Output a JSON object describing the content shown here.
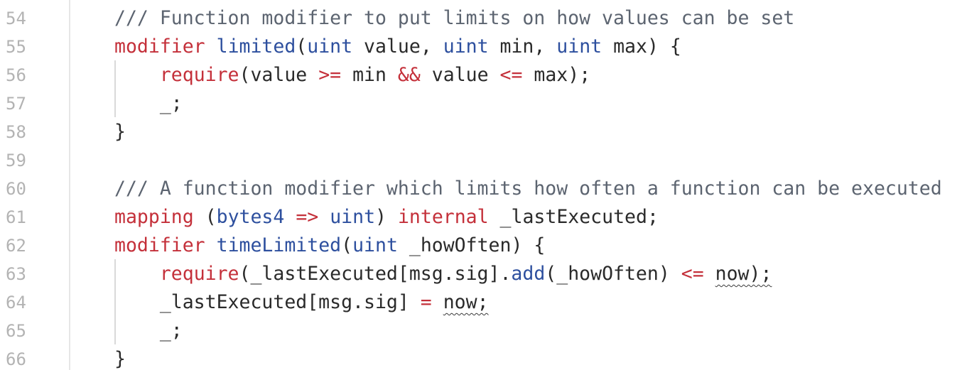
{
  "editor": {
    "lines": [
      {
        "num": "54",
        "tokens": [
          {
            "t": "/// Function modifier to put limits on how values can be set",
            "k": "cm"
          }
        ]
      },
      {
        "num": "55",
        "tokens": [
          {
            "t": "modifier",
            "k": "kw"
          },
          {
            "t": " ",
            "k": "plain"
          },
          {
            "t": "limited",
            "k": "fn"
          },
          {
            "t": "(",
            "k": "plain"
          },
          {
            "t": "uint",
            "k": "type"
          },
          {
            "t": " value, ",
            "k": "plain"
          },
          {
            "t": "uint",
            "k": "type"
          },
          {
            "t": " min, ",
            "k": "plain"
          },
          {
            "t": "uint",
            "k": "type"
          },
          {
            "t": " max) {",
            "k": "plain"
          }
        ]
      },
      {
        "num": "56",
        "tokens": [
          {
            "t": "    ",
            "k": "plain"
          },
          {
            "t": "require",
            "k": "kw"
          },
          {
            "t": "(value ",
            "k": "plain"
          },
          {
            "t": ">=",
            "k": "op"
          },
          {
            "t": " min ",
            "k": "plain"
          },
          {
            "t": "&&",
            "k": "op"
          },
          {
            "t": " value ",
            "k": "plain"
          },
          {
            "t": "<=",
            "k": "op"
          },
          {
            "t": " max);",
            "k": "plain"
          }
        ]
      },
      {
        "num": "57",
        "tokens": [
          {
            "t": "    _;",
            "k": "plain"
          }
        ]
      },
      {
        "num": "58",
        "tokens": [
          {
            "t": "}",
            "k": "plain"
          }
        ]
      },
      {
        "num": "59",
        "tokens": []
      },
      {
        "num": "60",
        "tokens": [
          {
            "t": "/// A function modifier which limits how often a function can be executed",
            "k": "cm"
          }
        ]
      },
      {
        "num": "61",
        "tokens": [
          {
            "t": "mapping",
            "k": "kw"
          },
          {
            "t": " (",
            "k": "plain"
          },
          {
            "t": "bytes4",
            "k": "type"
          },
          {
            "t": " ",
            "k": "plain"
          },
          {
            "t": "=>",
            "k": "op"
          },
          {
            "t": " ",
            "k": "plain"
          },
          {
            "t": "uint",
            "k": "type"
          },
          {
            "t": ") ",
            "k": "plain"
          },
          {
            "t": "internal",
            "k": "kw"
          },
          {
            "t": " _lastExecuted;",
            "k": "plain"
          }
        ]
      },
      {
        "num": "62",
        "tokens": [
          {
            "t": "modifier",
            "k": "kw"
          },
          {
            "t": " ",
            "k": "plain"
          },
          {
            "t": "timeLimited",
            "k": "fn"
          },
          {
            "t": "(",
            "k": "plain"
          },
          {
            "t": "uint",
            "k": "type"
          },
          {
            "t": " _howOften) {",
            "k": "plain"
          }
        ]
      },
      {
        "num": "63",
        "tokens": [
          {
            "t": "    ",
            "k": "plain"
          },
          {
            "t": "require",
            "k": "kw"
          },
          {
            "t": "(_lastExecuted[msg.sig].",
            "k": "plain"
          },
          {
            "t": "add",
            "k": "fn"
          },
          {
            "t": "(_howOften) ",
            "k": "plain"
          },
          {
            "t": "<=",
            "k": "op"
          },
          {
            "t": " ",
            "k": "plain"
          },
          {
            "t": "now);",
            "k": "squig"
          }
        ]
      },
      {
        "num": "64",
        "tokens": [
          {
            "t": "    _lastExecuted[msg.sig] ",
            "k": "plain"
          },
          {
            "t": "=",
            "k": "op"
          },
          {
            "t": " ",
            "k": "plain"
          },
          {
            "t": "now;",
            "k": "squig"
          }
        ]
      },
      {
        "num": "65",
        "tokens": [
          {
            "t": "    _;",
            "k": "plain"
          }
        ]
      },
      {
        "num": "66",
        "tokens": [
          {
            "t": "}",
            "k": "plain"
          }
        ]
      }
    ]
  }
}
